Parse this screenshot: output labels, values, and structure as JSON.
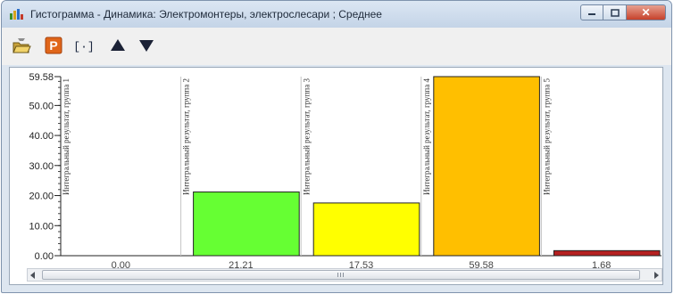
{
  "window": {
    "title": "Гистограмма - Динамика: Электромонтеры, электрослесари ; Среднее",
    "close_glyph": "✕"
  },
  "toolbar": {
    "items": [
      {
        "icon": "open-folder-icon"
      },
      {
        "icon": "p-icon",
        "label": "P"
      },
      {
        "icon": "width-icon",
        "label": "[·]"
      },
      {
        "icon": "arrow-up-icon"
      },
      {
        "icon": "arrow-down-icon"
      }
    ]
  },
  "chart_data": {
    "type": "bar",
    "ylim": [
      0,
      59.58
    ],
    "yticks": [
      "0.00",
      "10.00",
      "20.00",
      "30.00",
      "40.00",
      "50.00",
      "59.58"
    ],
    "ytick_values": [
      0,
      10,
      20,
      30,
      40,
      50,
      59.58
    ],
    "categories": [
      "Интегральный результат, группа 1",
      "Интегральный результат, группа 2",
      "Интегральный результат, группа 3",
      "Интегральный результат, группа 4",
      "Интегральный результат, группа 5"
    ],
    "values": [
      0.0,
      21.21,
      17.53,
      59.58,
      1.68
    ],
    "value_labels": [
      "0.00",
      "21.21",
      "17.53",
      "59.58",
      "1.68"
    ],
    "colors": [
      "#ffffff",
      "#66ff33",
      "#ffff00",
      "#ffbf00",
      "#b52020"
    ],
    "grid": false
  },
  "scrollbar": {
    "grip_glyph": "III"
  }
}
